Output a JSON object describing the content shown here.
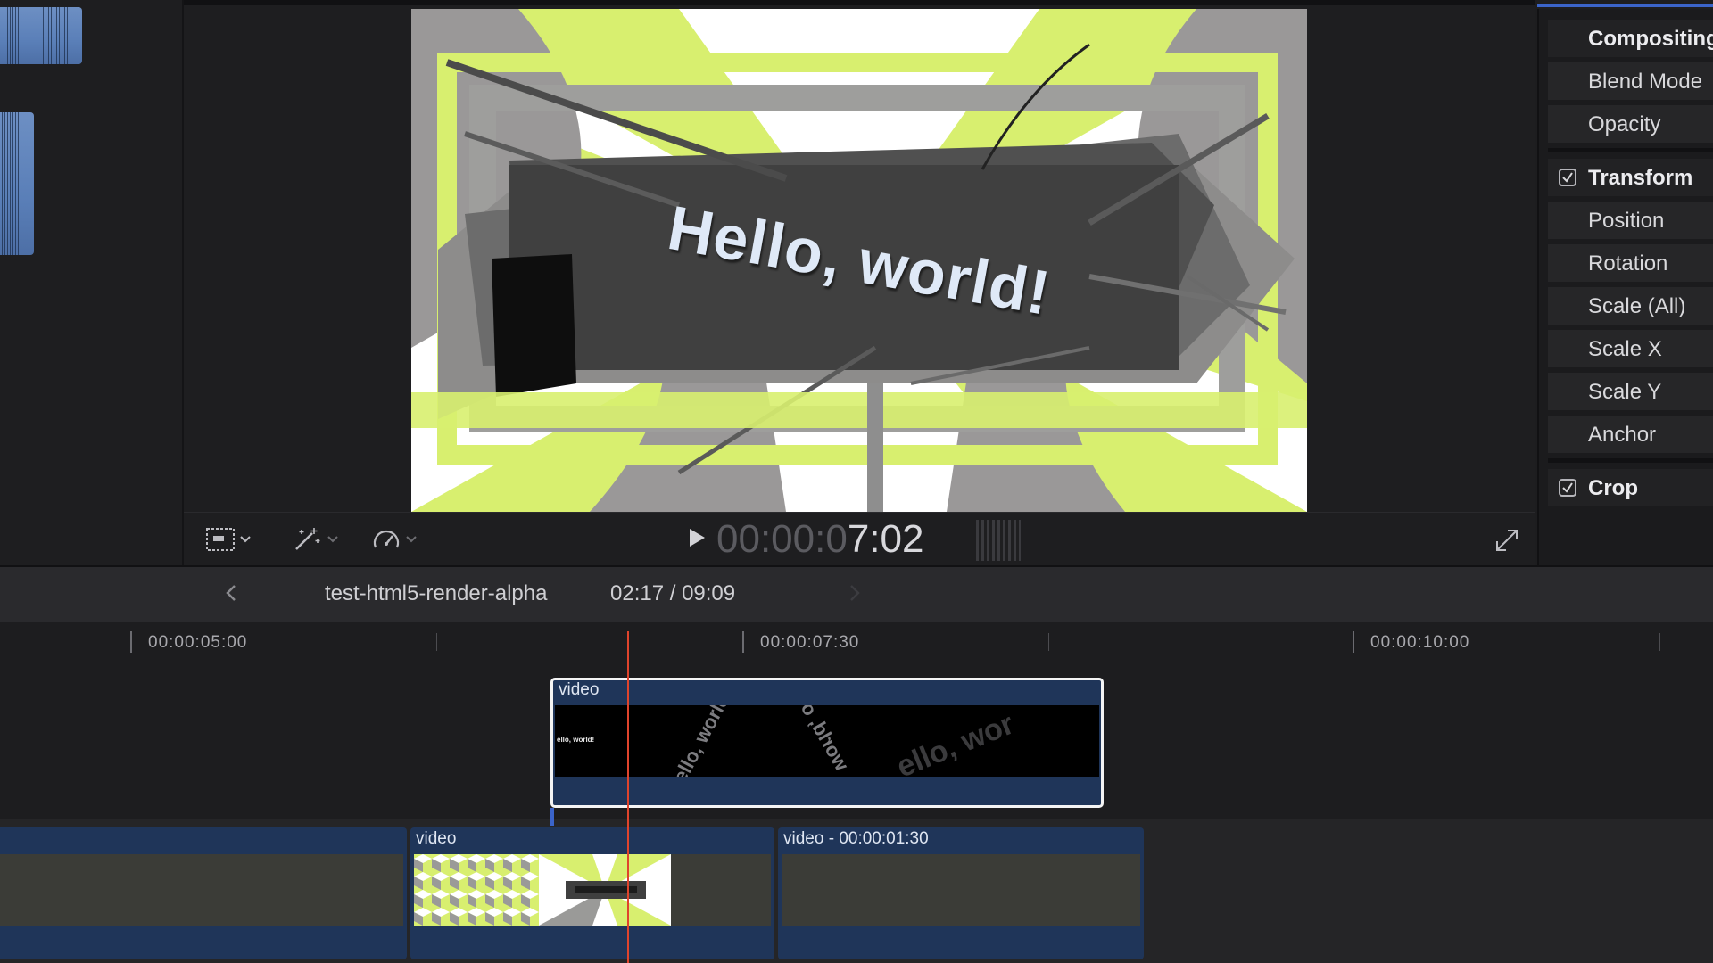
{
  "viewer": {
    "title_text": "Hello, world!",
    "timecode_dim": "00:00:0",
    "timecode_bright": "7:02"
  },
  "inspector": {
    "rows": [
      {
        "label": "Compositing",
        "type": "header",
        "checked": false
      },
      {
        "label": "Blend Mode",
        "type": "param"
      },
      {
        "label": "Opacity",
        "type": "param"
      },
      {
        "label": "Transform",
        "type": "header",
        "checked": true
      },
      {
        "label": "Position",
        "type": "param"
      },
      {
        "label": "Rotation",
        "type": "param"
      },
      {
        "label": "Scale (All)",
        "type": "param"
      },
      {
        "label": "Scale X",
        "type": "param"
      },
      {
        "label": "Scale Y",
        "type": "param"
      },
      {
        "label": "Anchor",
        "type": "param"
      },
      {
        "label": "Crop",
        "type": "header",
        "checked": true
      }
    ]
  },
  "timeline": {
    "project_name": "test-html5-render-alpha",
    "duration": "02:17 / 09:09",
    "ruler_labels": [
      "00:00:05:00",
      "00:00:07:30",
      "00:00:10:00"
    ],
    "clips": {
      "connected": "video",
      "primary_middle": "video",
      "primary_right": "video - 00:00:01:30"
    },
    "connected_thumb_small_text": "ello, world!",
    "connected_thumb_rot_text_1": "ello, world",
    "connected_thumb_rot_text_2": "world, o",
    "connected_thumb_rot_text_3": "ello, wor"
  },
  "colors": {
    "accent_blue": "#3b64c9",
    "playhead": "#e0442c",
    "clip_blue": "#1f3559",
    "lime": "#d8ef6f"
  },
  "icons": [
    "transform-tool-icon",
    "chevron-down-icon",
    "magic-wand-icon",
    "speed-gauge-icon",
    "play-icon",
    "fullscreen-icon",
    "chevron-left-icon",
    "chevron-right-icon",
    "checkbox-icon"
  ]
}
